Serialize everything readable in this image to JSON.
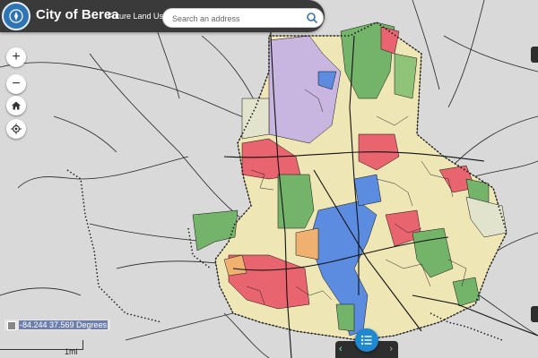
{
  "header": {
    "title": "City of Berea",
    "subtitle": "Future Land Use",
    "logo_icon": "compass-logo-icon"
  },
  "search": {
    "placeholder": "Search an address",
    "button_icon": "search-icon"
  },
  "controls": {
    "zoom_in_label": "+",
    "zoom_out_label": "−",
    "home_icon": "home-icon",
    "locate_icon": "locate-icon"
  },
  "coordinates": {
    "value": "-84.244 37.569 Degrees"
  },
  "scale": {
    "label": "1mi"
  },
  "bottom": {
    "prev_label": "‹",
    "next_label": "›",
    "list_icon": "list-icon"
  },
  "colors": {
    "background": "#d9d9d9",
    "road": "#222222",
    "boundary": "#111111",
    "commercial": "#e8646e",
    "institutional": "#b7a4d8",
    "residential": "#efe6b6",
    "park": "#74b46a",
    "industrial": "#5b8ce0",
    "mixed": "#f0b070",
    "rural": "#e2e3cc",
    "header": "#3a3a3a",
    "accent": "#1e88d0"
  }
}
